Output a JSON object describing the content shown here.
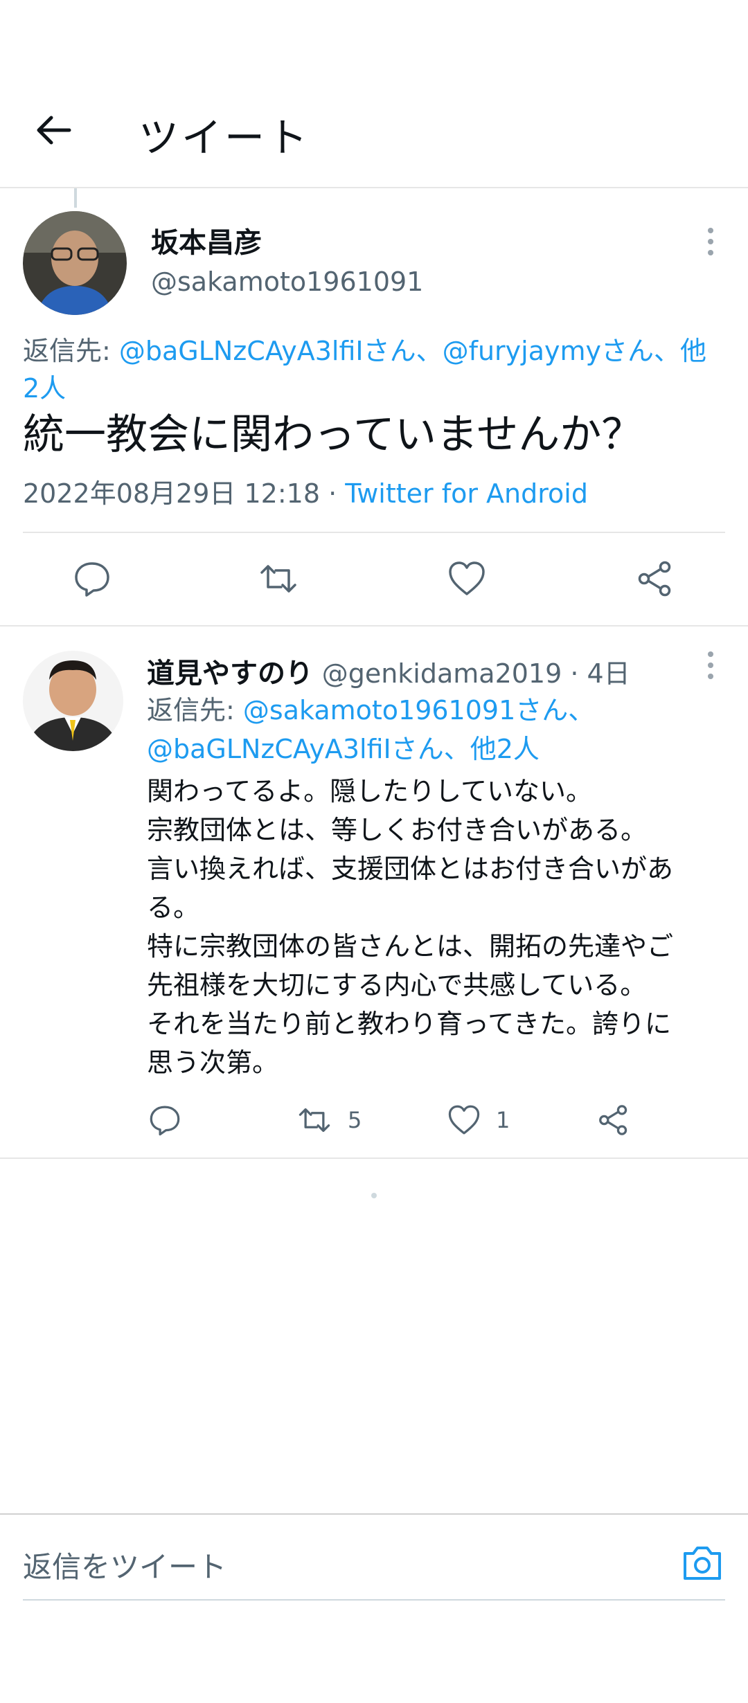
{
  "header": {
    "title": "ツイート"
  },
  "main_tweet": {
    "author_name": "坂本昌彦",
    "author_handle": "@sakamoto1961091",
    "reply_prefix": "返信先: ",
    "reply_to": "@baGLNzCAyA3lfiIさん、@furyjaymyさん、他2人",
    "text": "統一教会に関わっていませんか？",
    "timestamp": "2022年08月29日 12:18",
    "separator": " · ",
    "source": "Twitter for Android"
  },
  "reply_tweet": {
    "author_name": "道見やすのり",
    "author_handle": "@genkidama2019",
    "time_sep": " · ",
    "time": "4日",
    "reply_prefix": "返信先: ",
    "reply_to": "@sakamoto1961091さん、@baGLNzCAyA3lfiIさん、他2人",
    "lines": [
      "関わってるよ。隠したりしていない。",
      "宗教団体とは、等しくお付き合いがある。",
      "言い換えれば、支援団体とはお付き合いがあ",
      "る。",
      "特に宗教団体の皆さんとは、開拓の先達やご",
      "先祖様を大切にする内心で共感している。",
      "それを当たり前と教わり育ってきた。誇りに",
      "思う次第。"
    ],
    "retweet_count": "5",
    "like_count": "1"
  },
  "composer": {
    "placeholder": "返信をツイート"
  },
  "colors": {
    "link": "#1d9bf0",
    "secondary_text": "#536471",
    "divider": "#e6e6e6"
  },
  "icons": [
    "back-arrow-icon",
    "more-icon",
    "reply-icon",
    "retweet-icon",
    "like-icon",
    "share-icon",
    "camera-icon"
  ]
}
